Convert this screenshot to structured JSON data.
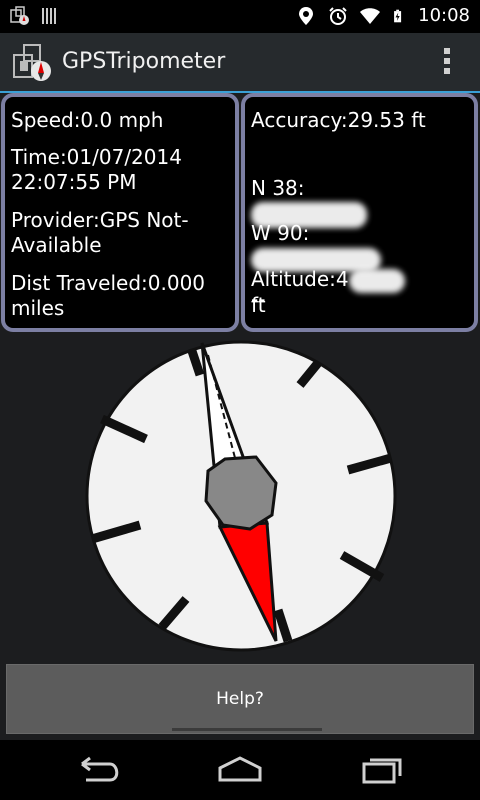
{
  "status_bar": {
    "time": "10:08",
    "icons": [
      "app-notification-icon",
      "barcode-icon",
      "location-icon",
      "alarm-icon",
      "wifi-icon",
      "battery-charging-icon"
    ]
  },
  "action_bar": {
    "title": "GPSTripometer",
    "icon": "gps-tripometer-app-icon",
    "menu_icon": "overflow-menu-icon"
  },
  "left_panel": {
    "speed": "Speed:0.0 mph",
    "time": "Time:01/07/2014\n22:07:55 PM",
    "provider": "Provider:GPS Not-\nAvailable",
    "distance": "Dist Traveled:0.000\nmiles"
  },
  "right_panel": {
    "accuracy": "Accuracy:29.53 ft",
    "north_prefix": "N 38:",
    "west_prefix": "W 90:",
    "altitude_prefix": "Altitude:4",
    "altitude_unit": "ft",
    "bearing": "--"
  },
  "compass": {
    "needle_colors": {
      "north": "#ffffff",
      "south": "#ff0000",
      "hub": "#888888"
    }
  },
  "help_button": {
    "label": "Help?"
  },
  "nav_bar": {
    "buttons": [
      "back-icon",
      "home-icon",
      "recent-apps-icon"
    ]
  }
}
